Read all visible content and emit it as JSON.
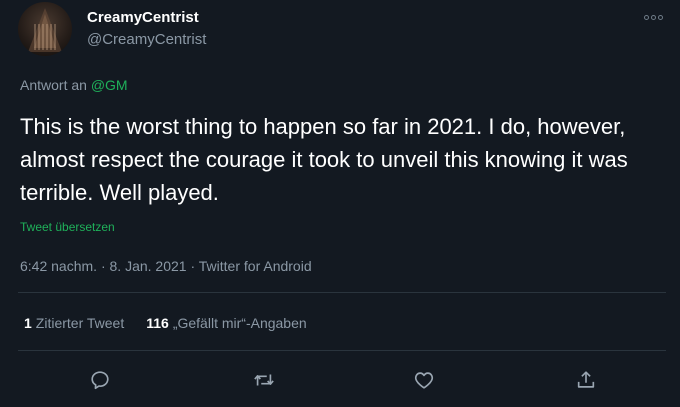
{
  "author": {
    "display_name": "CreamyCentrist",
    "handle": "@CreamyCentrist",
    "avatar_icon": "avatar-portrait"
  },
  "reply": {
    "prefix": "Antwort an",
    "target": "@GM"
  },
  "tweet": {
    "text": "This is the worst thing to happen so far in 2021. I do, however, almost respect the courage it took to unveil this knowing it was terrible. Well played.",
    "translate_label": "Tweet übersetzen"
  },
  "meta": {
    "time": "6:42 nachm.",
    "separator": "·",
    "date": "8. Jan. 2021",
    "source": "Twitter for Android"
  },
  "stats": {
    "quote_count": "1",
    "quote_label": "Zitierter Tweet",
    "like_count": "116",
    "like_label": "„Gefällt mir“-Angaben"
  },
  "actions": {
    "reply_icon": "speech-bubble-icon",
    "retweet_icon": "retweet-icon",
    "like_icon": "heart-icon",
    "share_icon": "share-icon"
  },
  "colors": {
    "background": "#131921",
    "accent": "#1fb15a",
    "muted": "#8b98a5",
    "divider": "#2a343d"
  }
}
